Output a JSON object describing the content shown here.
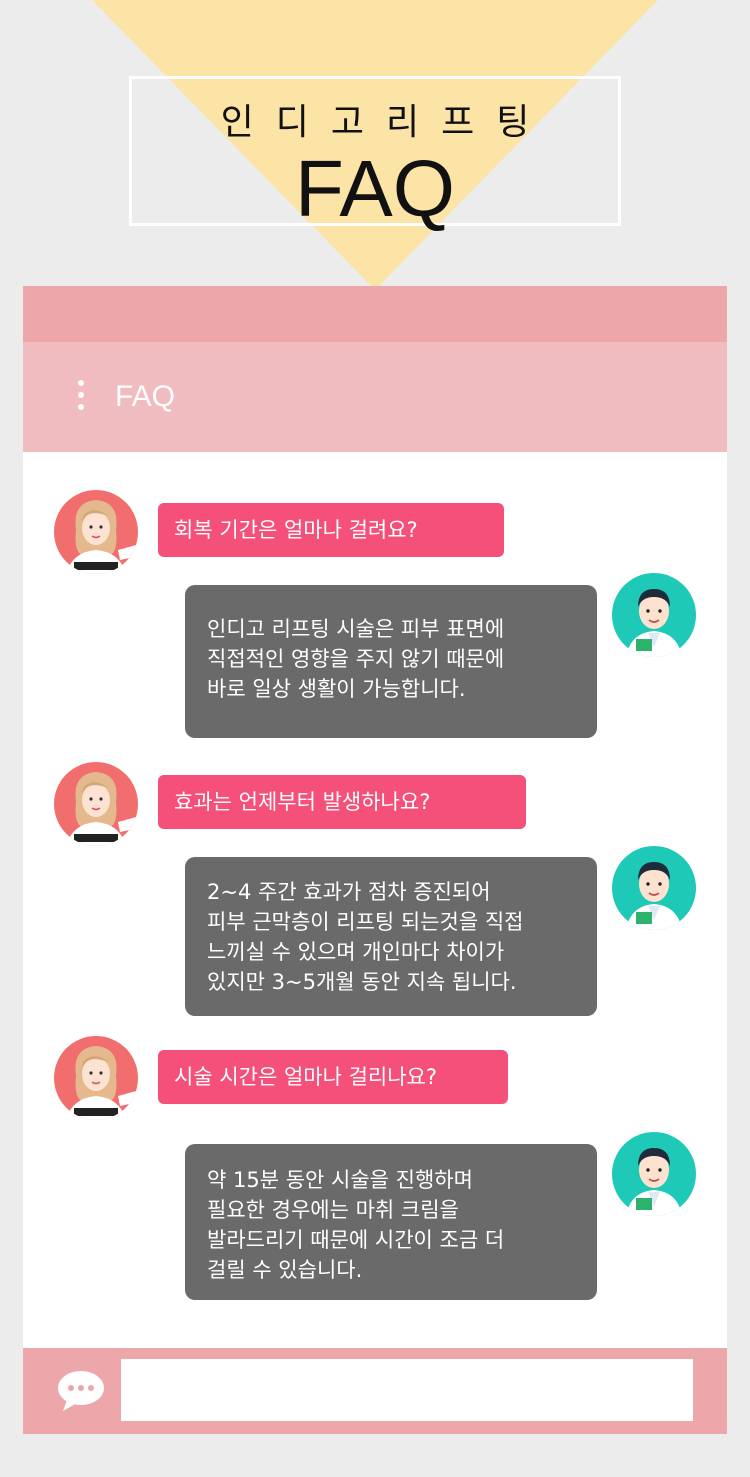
{
  "banner": {
    "subtitle": "인디고리프팅",
    "title": "FAQ",
    "spot_color": "#fce3a6"
  },
  "app": {
    "header_title": "FAQ",
    "colors": {
      "top_bar": "#eda7ab",
      "header": "#f1bcbf",
      "question_bubble": "#f5507a",
      "answer_bubble": "#6a6a6a",
      "avatar_user": "#f26d6d",
      "avatar_doctor": "#1ec9b8"
    },
    "input_placeholder": ""
  },
  "messages": [
    {
      "question": "회복 기간은 얼마나 걸려요?",
      "answer": "인디고 리프팅 시술은 피부 표면에\n직접적인 영향을 주지 않기 때문에\n바로 일상 생활이 가능합니다."
    },
    {
      "question": "효과는 언제부터 발생하나요?",
      "answer": "2~4 주간 효과가 점차 증진되어\n피부 근막층이 리프팅 되는것을 직접\n느끼실 수 있으며 개인마다 차이가\n있지만 3~5개월 동안 지속 됩니다."
    },
    {
      "question": "시술 시간은 얼마나 걸리나요?",
      "answer": "약 15분 동안 시술을 진행하며\n필요한 경우에는 마취 크림을\n발라드리기 때문에 시간이 조금 더\n걸릴 수 있습니다."
    }
  ],
  "icons": {
    "menu": "vertical-dots-icon",
    "chat": "speech-bubble-icon",
    "user_avatar": "woman-avatar-icon",
    "doctor_avatar": "doctor-avatar-icon"
  }
}
